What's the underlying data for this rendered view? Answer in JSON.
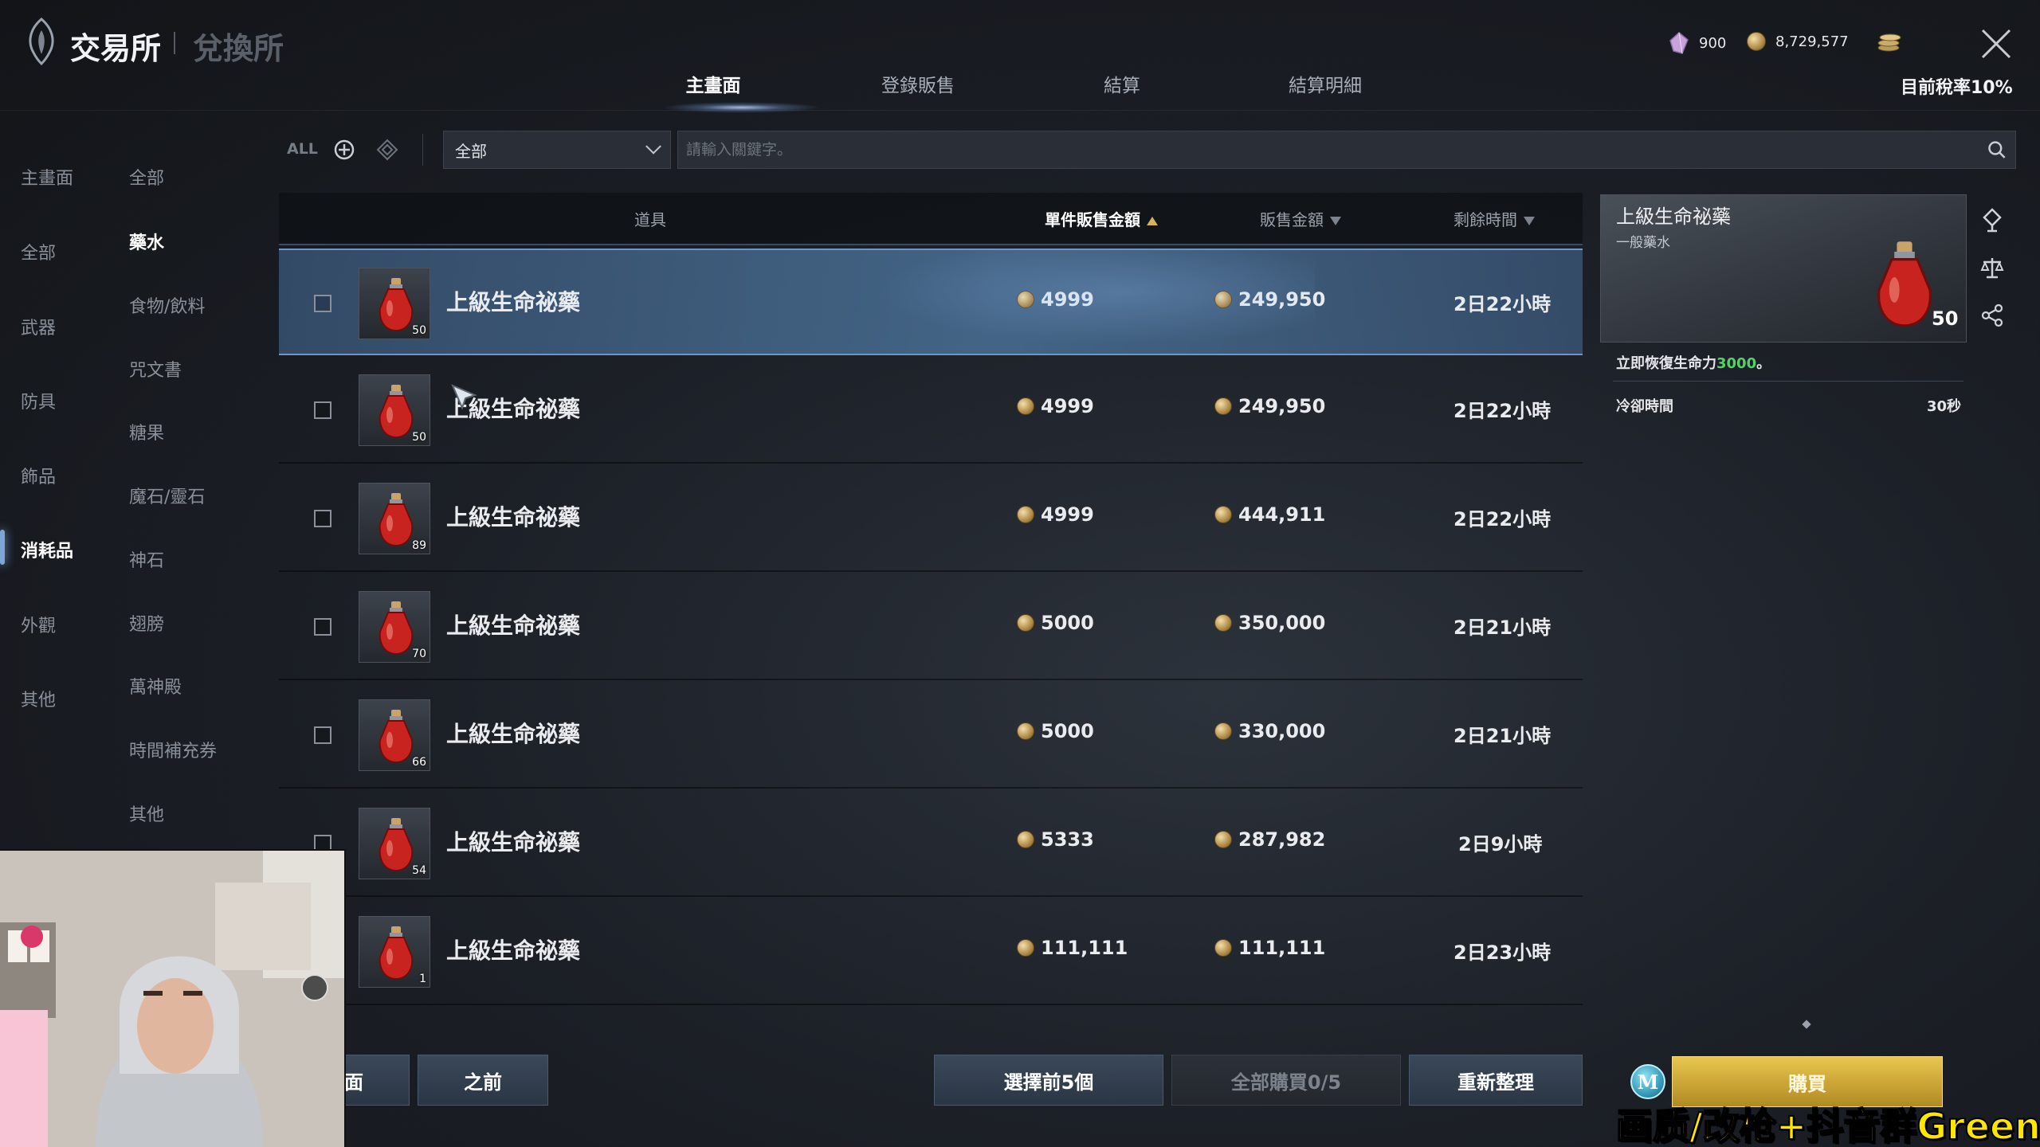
{
  "header": {
    "title": "交易所",
    "subtitle": "兌換所",
    "tabs": [
      "主畫面",
      "登錄販售",
      "結算",
      "結算明細"
    ],
    "active_tab": 0,
    "currency_crystal": "900",
    "currency_gold": "8,729,577",
    "tax_rate": "目前稅率10%"
  },
  "nav_primary": {
    "items": [
      "主畫面",
      "全部",
      "武器",
      "防具",
      "飾品",
      "消耗品",
      "外觀",
      "其他"
    ],
    "active": 5
  },
  "nav_secondary": {
    "items": [
      "全部",
      "藥水",
      "食物/飲料",
      "咒文書",
      "糖果",
      "魔石/靈石",
      "神石",
      "翅膀",
      "萬神殿",
      "時間補充券",
      "其他"
    ],
    "active": 1
  },
  "filter": {
    "all_label": "ALL",
    "category_value": "全部",
    "search_placeholder": "請輸入關鍵字。"
  },
  "table": {
    "columns": {
      "item": "道具",
      "unit_price": "單件販售金額",
      "total_price": "販售金額",
      "remaining": "剩餘時間"
    },
    "rows": [
      {
        "name": "上級生命祕藥",
        "qty": "50",
        "unit_price": "4999",
        "total": "249,950",
        "time": "2日22小時",
        "selected": true
      },
      {
        "name": "上級生命祕藥",
        "qty": "50",
        "unit_price": "4999",
        "total": "249,950",
        "time": "2日22小時",
        "selected": false
      },
      {
        "name": "上級生命祕藥",
        "qty": "89",
        "unit_price": "4999",
        "total": "444,911",
        "time": "2日22小時",
        "selected": false
      },
      {
        "name": "上級生命祕藥",
        "qty": "70",
        "unit_price": "5000",
        "total": "350,000",
        "time": "2日21小時",
        "selected": false
      },
      {
        "name": "上級生命祕藥",
        "qty": "66",
        "unit_price": "5000",
        "total": "330,000",
        "time": "2日21小時",
        "selected": false
      },
      {
        "name": "上級生命祕藥",
        "qty": "54",
        "unit_price": "5333",
        "total": "287,982",
        "time": "2日9小時",
        "selected": false
      },
      {
        "name": "上級生命祕藥",
        "qty": "1",
        "unit_price": "111,111",
        "total": "111,111",
        "time": "2日23小時",
        "selected": false
      }
    ]
  },
  "detail": {
    "name": "上級生命祕藥",
    "type": "一般藥水",
    "qty": "50",
    "effect_prefix": "立即恢復生命力",
    "effect_value": "3000",
    "effect_suffix": "。",
    "cooldown_label": "冷卻時間",
    "cooldown_value": "30秒"
  },
  "buttons": {
    "first_page": "前面",
    "prev": "之前",
    "select_first5": "選擇前5個",
    "buy_all": "全部購買0/5",
    "refresh": "重新整理",
    "buy": "購買",
    "m_label": "M"
  },
  "overlay_text": "画质/改枪+抖音群Green",
  "colors": {
    "accent_blue": "#6f95c6",
    "gold": "#d7b15c",
    "buy_yellow": "#e9c64e",
    "effect_green": "#57d06a"
  }
}
